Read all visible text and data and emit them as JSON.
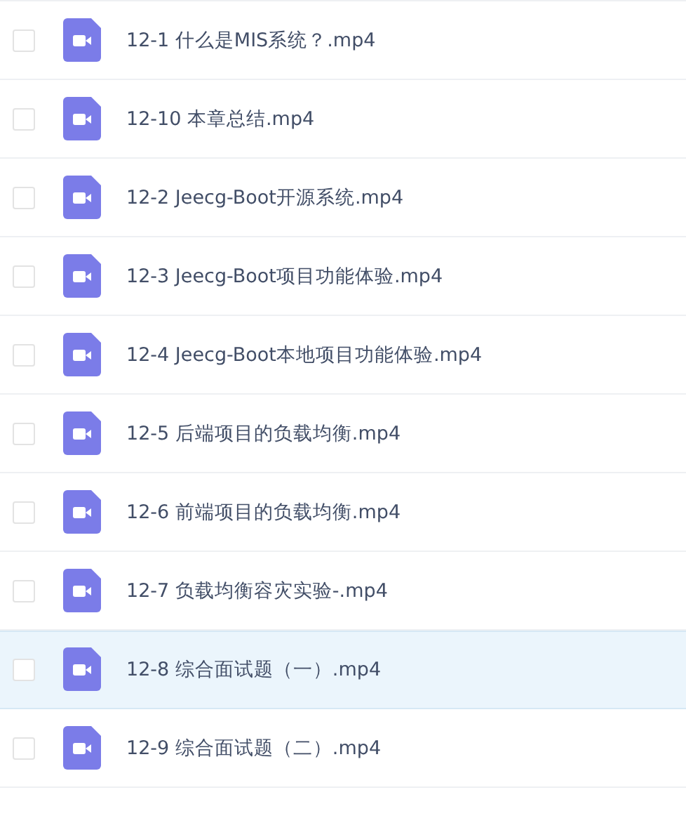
{
  "files": [
    {
      "name": "12-1 什么是MIS系统？.mp4",
      "checked": false,
      "highlighted": false
    },
    {
      "name": "12-10 本章总结.mp4",
      "checked": false,
      "highlighted": false
    },
    {
      "name": "12-2 Jeecg-Boot开源系统.mp4",
      "checked": false,
      "highlighted": false
    },
    {
      "name": "12-3 Jeecg-Boot项目功能体验.mp4",
      "checked": false,
      "highlighted": false
    },
    {
      "name": "12-4 Jeecg-Boot本地项目功能体验.mp4",
      "checked": false,
      "highlighted": false
    },
    {
      "name": "12-5 后端项目的负载均衡.mp4",
      "checked": false,
      "highlighted": false
    },
    {
      "name": "12-6 前端项目的负载均衡.mp4",
      "checked": false,
      "highlighted": false
    },
    {
      "name": "12-7 负载均衡容灾实验-.mp4",
      "checked": false,
      "highlighted": false
    },
    {
      "name": "12-8 综合面试题（一）.mp4",
      "checked": false,
      "highlighted": true
    },
    {
      "name": "12-9 综合面试题（二）.mp4",
      "checked": false,
      "highlighted": false
    }
  ]
}
